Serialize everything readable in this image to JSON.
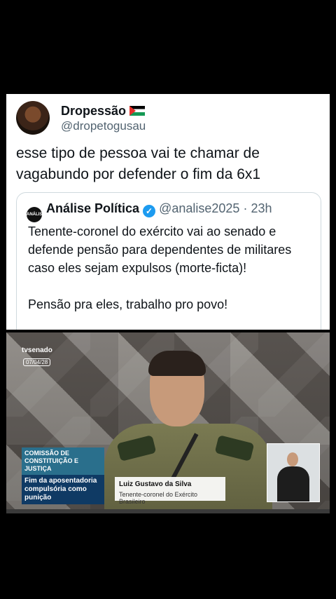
{
  "tweet": {
    "author_name": "Dropessão",
    "author_handle": "@dropetogusau",
    "text": "esse tipo de pessoa vai te chamar de vagabundo por defender o fim da 6x1",
    "quote": {
      "logo_text": "ANÁLISE POLÍTICA",
      "author_name": "Análise Política",
      "author_handle": "@analise2025",
      "separator": "·",
      "time": "23h",
      "text": "Tenente-coronel do exército vai ao senado e defende pensão para dependentes de militares caso eles sejam expulsos (morte-ficta)!\n\nPensão pra eles, trabalho pro povo!"
    }
  },
  "video": {
    "channel": "tvsenado",
    "date": "07/04/28",
    "committee": "COMISSÃO DE CONSTITUIÇÃO E JUSTIÇA",
    "headline": "Fim da aposentadoria compulsória como punição",
    "speaker_name": "Luiz Gustavo da Silva",
    "speaker_title": "Tenente-coronel do Exército Brasileiro"
  }
}
